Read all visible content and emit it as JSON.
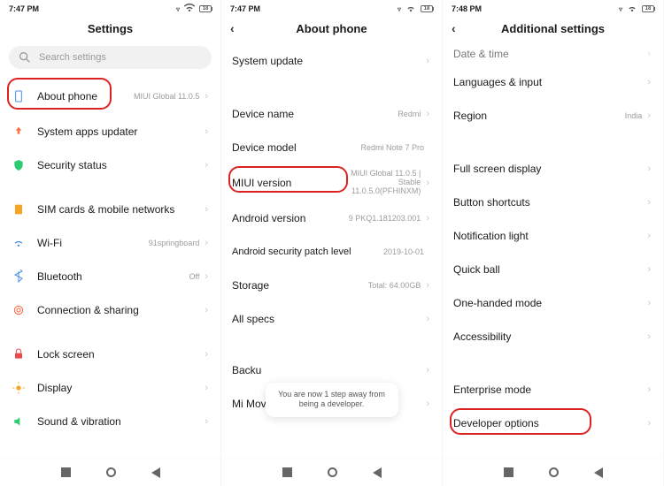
{
  "status": {
    "time_a": "7:47 PM",
    "time_b": "7:47 PM",
    "time_c": "7:48 PM",
    "batt": "18"
  },
  "col1": {
    "title": "Settings",
    "search_placeholder": "Search settings",
    "items": [
      {
        "label": "About phone",
        "value": "MIUI Global 11.0.5"
      },
      {
        "label": "System apps updater",
        "value": ""
      },
      {
        "label": "Security status",
        "value": ""
      },
      {
        "label": "SIM cards & mobile networks",
        "value": ""
      },
      {
        "label": "Wi-Fi",
        "value": "91springboard"
      },
      {
        "label": "Bluetooth",
        "value": "Off"
      },
      {
        "label": "Connection & sharing",
        "value": ""
      },
      {
        "label": "Lock screen",
        "value": ""
      },
      {
        "label": "Display",
        "value": ""
      },
      {
        "label": "Sound & vibration",
        "value": ""
      }
    ]
  },
  "col2": {
    "title": "About phone",
    "items": [
      {
        "label": "System update",
        "value": ""
      },
      {
        "label": "Device name",
        "value": "Redmi"
      },
      {
        "label": "Device model",
        "value": "Redmi Note 7 Pro",
        "no_chevron": true
      },
      {
        "label": "MIUI version",
        "value": "MIUI Global 11.0.5 | Stable 11.0.5.0(PFHINXM)"
      },
      {
        "label": "Android version",
        "value": "9 PKQ1.181203.001"
      },
      {
        "label": "Android security patch level",
        "value": "2019-10-01",
        "no_chevron": true
      },
      {
        "label": "Storage",
        "value": "Total: 64.00GB"
      },
      {
        "label": "All specs",
        "value": ""
      },
      {
        "label": "Backu",
        "value": ""
      },
      {
        "label": "Mi Mover",
        "value": ""
      }
    ],
    "toast": "You are now 1 step away from being a developer."
  },
  "col3": {
    "title": "Additional settings",
    "items": [
      {
        "label": "Date & time",
        "value": ""
      },
      {
        "label": "Languages & input",
        "value": ""
      },
      {
        "label": "Region",
        "value": "India"
      },
      {
        "label": "Full screen display",
        "value": ""
      },
      {
        "label": "Button shortcuts",
        "value": ""
      },
      {
        "label": "Notification light",
        "value": ""
      },
      {
        "label": "Quick ball",
        "value": ""
      },
      {
        "label": "One-handed mode",
        "value": ""
      },
      {
        "label": "Accessibility",
        "value": ""
      },
      {
        "label": "Enterprise mode",
        "value": ""
      },
      {
        "label": "Developer options",
        "value": ""
      }
    ]
  }
}
